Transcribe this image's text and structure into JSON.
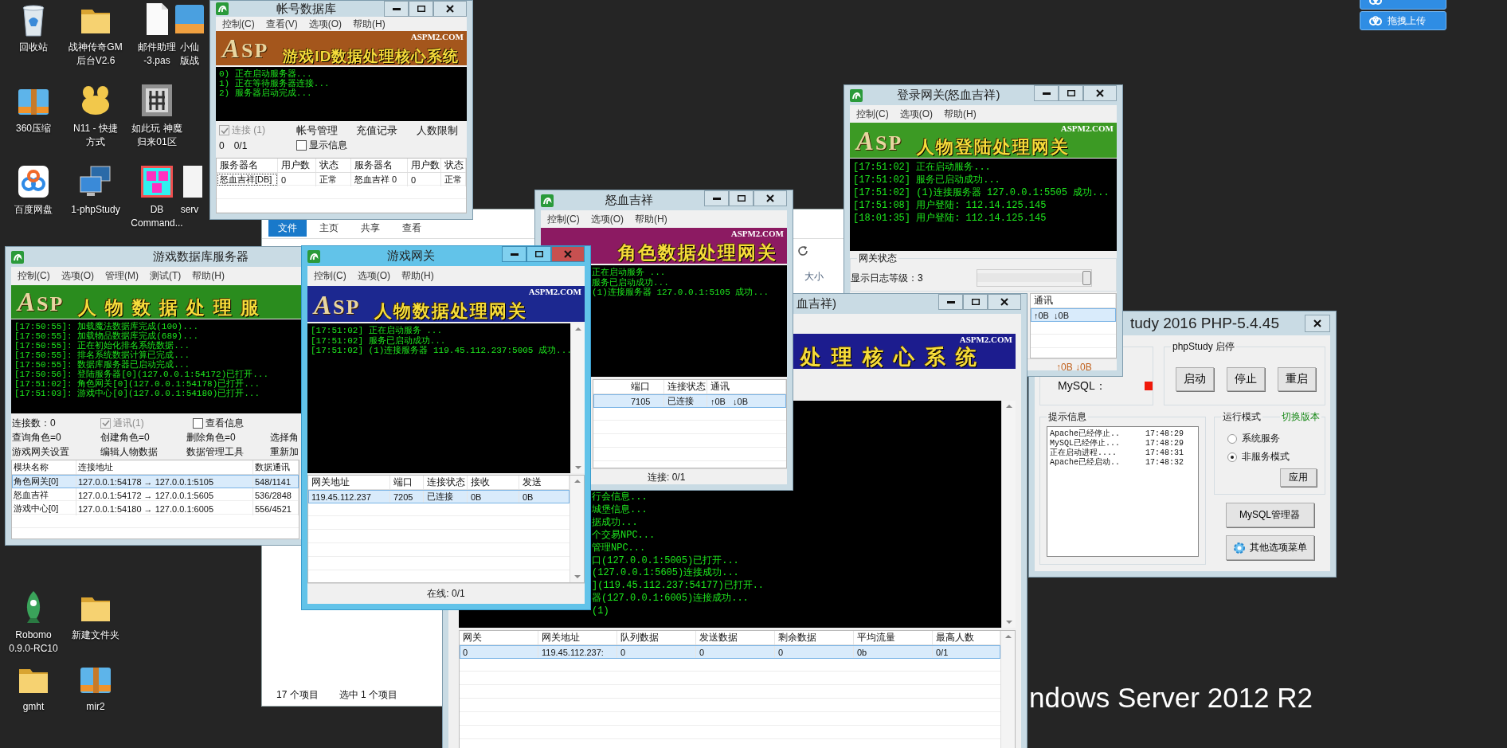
{
  "desktop_icons": [
    {
      "kind": "recycle",
      "label_lines": [
        "回收站"
      ]
    },
    {
      "kind": "folder",
      "label_lines": [
        "战神传奇GM",
        "后台V2.6"
      ]
    },
    {
      "kind": "file",
      "label_lines": [
        "邮件助理",
        "-3.pas"
      ]
    },
    {
      "kind": "app",
      "label_lines": [
        "小仙",
        "版战"
      ]
    },
    {
      "kind": "archive",
      "label_lines": [
        "360压缩"
      ]
    },
    {
      "kind": "blob",
      "label_lines": [
        "N11 - 快捷",
        "方式"
      ]
    },
    {
      "kind": "tile",
      "label_lines": [
        "如此玩 神魔",
        "归来01区"
      ]
    },
    {
      "kind": "cloud",
      "label_lines": [
        "百度网盘"
      ]
    },
    {
      "kind": "computer",
      "label_lines": [
        "1-phpStudy"
      ]
    },
    {
      "kind": "dbtile",
      "label_lines": [
        "DB",
        "Command..."
      ]
    },
    {
      "kind": "blank",
      "label_lines": [
        "serv"
      ]
    },
    {
      "kind": "rocket",
      "label_lines": [
        "Robomo",
        "0.9.0-RC10"
      ]
    },
    {
      "kind": "folder",
      "label_lines": [
        "新建文件夹"
      ]
    },
    {
      "kind": "folder",
      "label_lines": [
        "gmht"
      ]
    },
    {
      "kind": "archive",
      "label_lines": [
        "mir2"
      ]
    }
  ],
  "cloud_buttons": [
    {
      "kind": "icon_only"
    },
    {
      "kind": "labeled",
      "label": "拖拽上传"
    }
  ],
  "os_brand": "ndows Server 2012 R2",
  "windows": [
    {
      "kind": "explorer",
      "sections": [
        {
          "kind": "ribbon",
          "tabs": [
            {
              "label": "文件",
              "selected": true
            },
            {
              "label": "主页",
              "selected": false
            },
            {
              "label": "共享",
              "selected": false
            },
            {
              "label": "查看",
              "selected": false
            }
          ]
        },
        {
          "kind": "address_bar"
        },
        {
          "kind": "file_list",
          "columns": [
            "大小"
          ]
        },
        {
          "kind": "status",
          "items": [
            "17 个项目",
            "选中 1 个项目"
          ]
        }
      ]
    },
    {
      "kind": "php",
      "title": "tudy 2016   PHP-5.4.45",
      "active": false,
      "caption": {
        "close": true
      },
      "sections": [
        {
          "kind": "php_panel",
          "service": {
            "label": "MySQL：",
            "running": false
          },
          "control_group": {
            "title": "phpStudy 启停",
            "buttons": [
              "启动",
              "停止",
              "重启"
            ]
          },
          "info": {
            "title": "提示信息",
            "lines": [
              {
                "text": "Apache已经停止..",
                "time": "17:48:29"
              },
              {
                "text": "MySQL已经停止...",
                "time": "17:48:29"
              },
              {
                "text": "正在启动进程....",
                "time": "17:48:31"
              },
              {
                "text": "Apache已经启动..",
                "time": "17:48:32"
              }
            ]
          },
          "mode": {
            "title": "运行模式",
            "link": "切换版本",
            "options": [
              {
                "label": "系统服务",
                "selected": false
              },
              {
                "label": "非服务模式",
                "selected": true
              }
            ],
            "apply": "应用"
          },
          "buttons": [
            {
              "kind": "plain",
              "label": "MySQL管理器"
            },
            {
              "kind": "gear",
              "label": "其他选项菜单"
            }
          ]
        }
      ]
    },
    {
      "kind": "login_gate",
      "title": "登录网关(怒血吉祥)",
      "active": false,
      "caption": {
        "minimize": true,
        "maximize": true,
        "close": true
      },
      "sections": [
        {
          "kind": "menu",
          "items": [
            "控制(C)",
            "选项(O)",
            "帮助(H)"
          ]
        },
        {
          "kind": "banner",
          "logo": "ASP",
          "title": "人物登陆处理网关",
          "brand": "ASPM2.COM",
          "color": "#3c9a24"
        },
        {
          "kind": "log",
          "lines": [
            "[17:51:02] 正在启动服务...",
            "[17:51:02] 服务已启动成功...",
            "[17:51:02] (1)连接服务器 127.0.0.1:5505 成功...",
            "[17:51:08] 用户登陆: 112.14.125.145",
            "[18:01:35] 用户登陆: 112.14.125.145"
          ]
        },
        {
          "kind": "gate_status",
          "title": "网关状态",
          "label": "显示日志等级：3",
          "level": 1
        },
        {
          "kind": "table",
          "columns": [
            "通讯"
          ],
          "rows": [
            {
              "cells": [
                "↑0B  ↓0B"
              ],
              "selected": true
            }
          ]
        },
        {
          "kind": "status",
          "items": [
            "↑0B ↓0B"
          ]
        }
      ]
    },
    {
      "kind": "m2",
      "title": "血吉祥)",
      "active": false,
      "caption": {
        "minimize": true,
        "maximize": true,
        "close": true
      },
      "sections": [
        {
          "kind": "banner",
          "title": "处理核心系统",
          "brand": "ASPM2.COM",
          "color": "#1c1c8e"
        },
        {
          "kind": "log",
          "scrollbar": true,
          "lines": [
            "行会信息...",
            "城堡信息...",
            "据成功...",
            "个交易NPC...",
            "管理NPC...",
            "口(127.0.0.1:5005)已打开...",
            "(127.0.0.1:5605)连接成功...",
            "](119.45.112.237:54177)已打开..",
            "器(127.0.0.1:6005)连接成功...",
            "(1)"
          ]
        },
        {
          "kind": "table",
          "scrollbar": true,
          "columns": [
            "网关",
            "网关地址",
            "队列数据",
            "发送数据",
            "剩余数据",
            "平均流量",
            "最高人数"
          ],
          "rows": [
            {
              "cells": [
                "0",
                "119.45.112.237:",
                "0",
                "0",
                "0",
                "0b",
                "0/1"
              ],
              "selected": true
            }
          ]
        }
      ]
    },
    {
      "kind": "role_gate",
      "title": "怒血吉祥",
      "active": false,
      "caption": {
        "minimize": true,
        "maximize": true,
        "close": true
      },
      "sections": [
        {
          "kind": "menu",
          "items": [
            "控制(C)",
            "选项(O)",
            "帮助(H)"
          ]
        },
        {
          "kind": "banner",
          "title": "角色数据处理网关",
          "brand": "ASPM2.COM",
          "color": "#8c1a62"
        },
        {
          "kind": "log",
          "lines": [
            "正在启动服务 ...",
            "服务已启动成功...",
            "(1)连接服务器 127.0.0.1:5105 成功..."
          ]
        },
        {
          "kind": "table",
          "columns": [
            "端口",
            "连接状态",
            "通讯"
          ],
          "rows": [
            {
              "cells": [
                "7105",
                "已连接",
                "↑0B   ↓0B"
              ],
              "selected": true
            }
          ]
        },
        {
          "kind": "status",
          "items": [
            "连接: 0/1"
          ]
        }
      ]
    },
    {
      "kind": "db_server",
      "title": "游戏数据库服务器",
      "active": false,
      "sections": [
        {
          "kind": "menu",
          "items": [
            "控制(C)",
            "选项(O)",
            "管理(M)",
            "测试(T)",
            "帮助(H)"
          ]
        },
        {
          "kind": "banner",
          "logo": "ASP",
          "title": "人物数据处理服",
          "color": "#2a8c1e"
        },
        {
          "kind": "log",
          "lines": [
            "[17:50:55]: 加载魔法数据库完成(100)...",
            "[17:50:55]: 加载物品数据库完成(689)...",
            "[17:50:55]: 正在初始化排名系统数据...",
            "[17:50:55]: 排名系统数据计算已完成...",
            "[17:50:55]: 数据库服务器已启动完成...",
            "[17:50:56]: 登陆服务器[0](127.0.0.1:54172)已打开...",
            "[17:51:02]: 角色网关[0](127.0.0.1:54178)已打开...",
            "[17:51:03]: 游戏中心[0](127.0.0.1:54180)已打开..."
          ]
        },
        {
          "kind": "db_controls",
          "connections": "连接数：0",
          "comm": {
            "label": "通讯(1)",
            "checked": true,
            "disabled": true
          },
          "view_info": {
            "label": "查看信息",
            "checked": false
          },
          "stats": [
            "查询角色=0",
            "创建角色=0",
            "删除角色=0",
            "选择角"
          ],
          "tools": [
            "游戏网关设置",
            "编辑人物数据",
            "数据管理工具",
            "重新加"
          ]
        },
        {
          "kind": "table",
          "columns": [
            "模块名称",
            "连接地址",
            "数据通讯"
          ],
          "rows": [
            {
              "cells": [
                "角色网关[0]",
                "127.0.0.1:54178 → 127.0.0.1:5105",
                "548/1141"
              ],
              "selected": true
            },
            {
              "cells": [
                "怒血吉祥",
                "127.0.0.1:54172 → 127.0.0.1:5605",
                "536/2848"
              ],
              "selected": false
            },
            {
              "cells": [
                "游戏中心[0]",
                "127.0.0.1:54180 → 127.0.0.1:6005",
                "556/4521"
              ],
              "selected": false
            }
          ]
        }
      ]
    },
    {
      "kind": "account_db",
      "title": "帐号数据库",
      "active": false,
      "caption": {
        "minimize": true,
        "maximize": true,
        "close": true
      },
      "sections": [
        {
          "kind": "menu",
          "items": [
            "控制(C)",
            "查看(V)",
            "选项(O)",
            "帮助(H)"
          ]
        },
        {
          "kind": "banner",
          "logo": "ASP",
          "title": "游戏ID数据处理核心系统",
          "brand": "ASPM2.COM",
          "color": "#a4561c"
        },
        {
          "kind": "log",
          "lines": [
            "0) 正在启动服务器...",
            "1) 正在等待服务器连接...",
            "2) 服务器启动完成..."
          ]
        },
        {
          "kind": "account_controls",
          "connect": {
            "label": "连接 (1)",
            "checked": true,
            "disabled": true
          },
          "links": [
            "帐号管理",
            "充值记录",
            "人数限制"
          ],
          "counts": [
            "0",
            "0/1"
          ],
          "show_info": {
            "label": "显示信息",
            "checked": false
          }
        },
        {
          "kind": "table",
          "columns": [
            "服务器名",
            "用户数",
            "状态",
            "服务器名",
            "用户数",
            "状态"
          ],
          "rows": [
            {
              "cells": [
                "怒血吉祥[DB]",
                "0",
                "正常",
                "怒血吉祥 0",
                "0",
                "正常"
              ],
              "selected": false
            }
          ]
        }
      ]
    },
    {
      "kind": "game_gate",
      "title": "游戏网关",
      "active": true,
      "caption": {
        "minimize": true,
        "maximize": true,
        "close": true
      },
      "sections": [
        {
          "kind": "menu",
          "items": [
            "控制(C)",
            "选项(O)",
            "帮助(H)"
          ]
        },
        {
          "kind": "banner",
          "logo": "ASP",
          "title": "人物数据处理网关",
          "brand": "ASPM2.COM",
          "color": "#1c2890"
        },
        {
          "kind": "log",
          "scrollbar": true,
          "lines": [
            "[17:51:02] 正在启动服务 ...",
            "[17:51:02] 服务已启动成功...",
            "[17:51:02] (1)连接服务器 119.45.112.237:5005 成功..."
          ]
        },
        {
          "kind": "table",
          "scrollbar": true,
          "columns": [
            "网关地址",
            "端口",
            "连接状态",
            "接收",
            "发送"
          ],
          "rows": [
            {
              "cells": [
                "119.45.112.237",
                "7205",
                "已连接",
                "0B",
                "0B"
              ],
              "selected": true
            }
          ]
        },
        {
          "kind": "status",
          "items": [
            "在线: 0/1"
          ]
        }
      ]
    }
  ]
}
